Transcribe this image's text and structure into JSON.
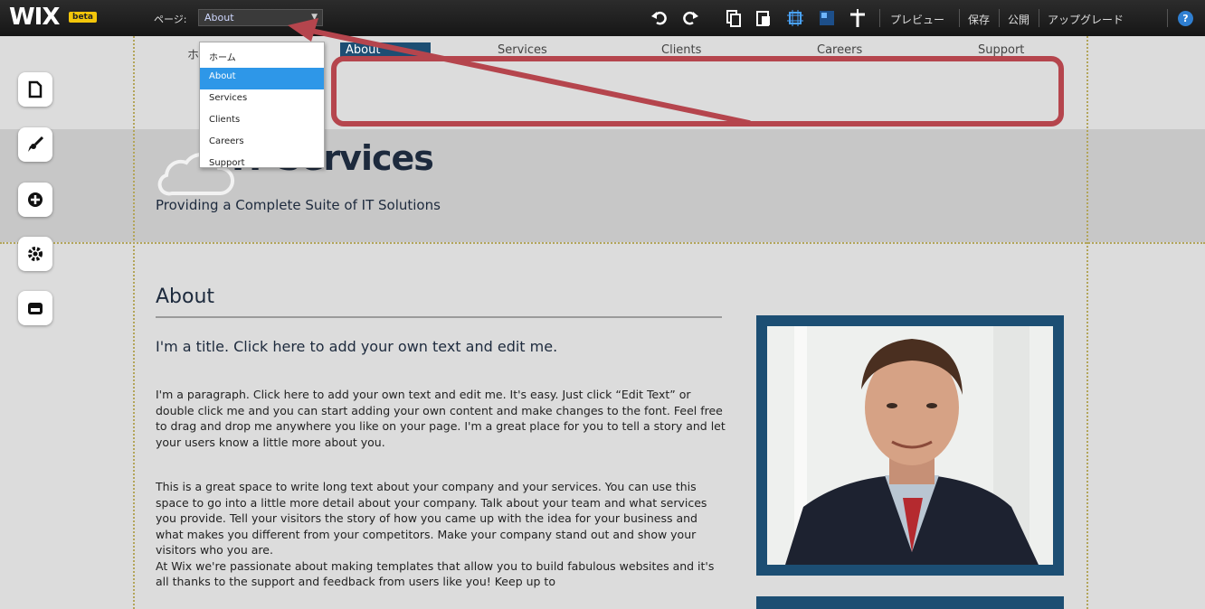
{
  "topbar": {
    "logo": "WIX",
    "beta_badge": "beta",
    "page_label": "ページ:",
    "page_select_value": "About",
    "preview": "プレビュー",
    "save": "保存",
    "publish": "公開",
    "upgrade": "アップグレード",
    "help": "?"
  },
  "page_dropdown": {
    "options": [
      "ホーム",
      "About",
      "Services",
      "Clients",
      "Careers",
      "Support"
    ],
    "selected": "About"
  },
  "nav": {
    "home_fragment": "ホ",
    "about": "About",
    "services": "Services",
    "clients": "Clients",
    "careers": "Careers",
    "support": "Support"
  },
  "brand": {
    "title": "IT Services",
    "subtitle": "Providing a Complete Suite of IT Solutions"
  },
  "content": {
    "heading": "About",
    "title": "I'm a title. Click here to add your own text and edit me.",
    "paragraph1": "I'm a paragraph. Click here to add your own text and edit me. It's easy. Just click “Edit Text” or double click me and you can start adding your own content and make changes to the font. Feel free to drag and drop me anywhere you like on your page. I'm a great place for you to tell a story and let your users know a little more about you.",
    "paragraph2": "This is a great space to write long text about your company and your services. You can use this space to go into a little more detail about your company. Talk about your team and what services you provide. Tell your visitors the story of how you came up with the idea for your business and what makes you different from your competitors. Make your company stand out and show your visitors who you are.",
    "paragraph3": "At Wix we're passionate about making templates that allow you to build fabulous websites and it's all thanks to the support and feedback from users like you! Keep up to"
  },
  "colors": {
    "accent_blue": "#1c4e73",
    "highlight_red": "#b5454d",
    "dropdown_selected": "#2e97e8"
  }
}
